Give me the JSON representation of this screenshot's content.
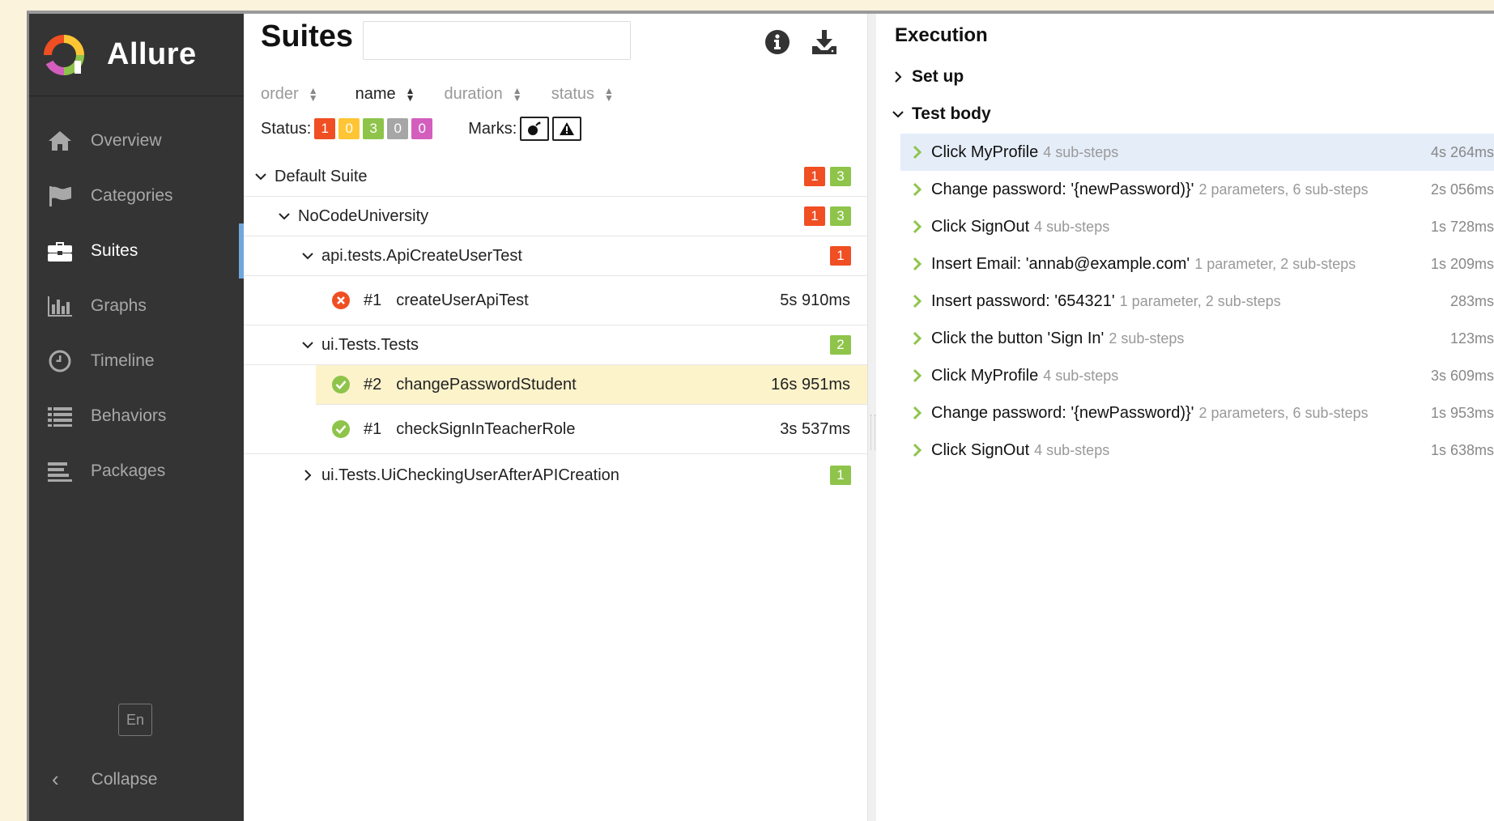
{
  "sidebar": {
    "brand": "Allure",
    "items": [
      {
        "label": "Overview",
        "icon": "home-icon"
      },
      {
        "label": "Categories",
        "icon": "flag-icon"
      },
      {
        "label": "Suites",
        "icon": "briefcase-icon"
      },
      {
        "label": "Graphs",
        "icon": "bar-chart-icon"
      },
      {
        "label": "Timeline",
        "icon": "clock-icon"
      },
      {
        "label": "Behaviors",
        "icon": "list-icon"
      },
      {
        "label": "Packages",
        "icon": "align-left-icon"
      }
    ],
    "active": "Suites",
    "language": "En",
    "collapse": "Collapse"
  },
  "suites": {
    "title": "Suites",
    "search_value": "",
    "sort": [
      "order",
      "name",
      "duration",
      "status"
    ],
    "sort_active": "name",
    "status_label": "Status:",
    "status_counts": {
      "failed": "1",
      "broken": "0",
      "passed": "3",
      "skipped": "0",
      "unknown": "0"
    },
    "marks_label": "Marks:",
    "tree": {
      "default_suite": {
        "label": "Default Suite",
        "failed": "1",
        "passed": "3"
      },
      "university": {
        "label": "NoCodeUniversity",
        "failed": "1",
        "passed": "3"
      },
      "api_suite": {
        "label": "api.tests.ApiCreateUserTest",
        "failed": "1"
      },
      "api_test": {
        "num": "#1",
        "name": "createUserApiTest",
        "duration": "5s 910ms"
      },
      "ui_suite": {
        "label": "ui.Tests.Tests",
        "passed": "2"
      },
      "ui_test1": {
        "num": "#2",
        "name": "changePasswordStudent",
        "duration": "16s 951ms"
      },
      "ui_test2": {
        "num": "#1",
        "name": "checkSignInTeacherRole",
        "duration": "3s 537ms"
      },
      "ui_suite2": {
        "label": "ui.Tests.UiCheckingUserAfterAPICreation",
        "passed": "1"
      }
    }
  },
  "execution": {
    "title": "Execution",
    "setup": "Set up",
    "body": "Test body",
    "steps": [
      {
        "name": "Click MyProfile",
        "meta": "4 sub-steps",
        "duration": "4s 264ms"
      },
      {
        "name": "Change password: '{newPassword)}'",
        "meta": "2 parameters, 6 sub-steps",
        "duration": "2s 056ms"
      },
      {
        "name": "Click SignOut",
        "meta": "4 sub-steps",
        "duration": "1s 728ms"
      },
      {
        "name": "Insert Email: 'annab@example.com'",
        "meta": "1 parameter, 2 sub-steps",
        "duration": "1s 209ms"
      },
      {
        "name": "Insert password: '654321'",
        "meta": "1 parameter, 2 sub-steps",
        "duration": "283ms"
      },
      {
        "name": "Click the button 'Sign In'",
        "meta": "2 sub-steps",
        "duration": "123ms"
      },
      {
        "name": "Click MyProfile",
        "meta": "4 sub-steps",
        "duration": "3s 609ms"
      },
      {
        "name": "Change password: '{newPassword)}'",
        "meta": "2 parameters, 6 sub-steps",
        "duration": "1s 953ms"
      },
      {
        "name": "Click SignOut",
        "meta": "4 sub-steps",
        "duration": "1s 638ms"
      }
    ]
  },
  "colors": {
    "failed": "#f04e23",
    "broken": "#ffc534",
    "passed": "#8ec44a",
    "skipped": "#a6a6a6",
    "unknown": "#d35ebe",
    "sidebar": "#343434",
    "accent": "#6fa8dc"
  }
}
